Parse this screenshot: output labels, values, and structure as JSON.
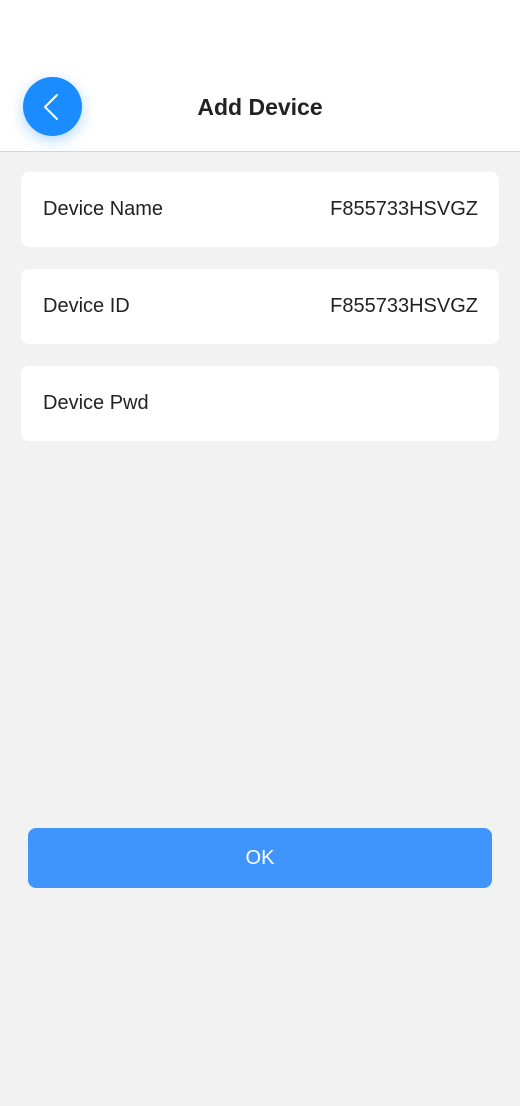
{
  "header": {
    "title": "Add Device",
    "back_icon": "chevron-left-icon"
  },
  "fields": [
    {
      "label": "Device Name",
      "value": "F855733HSVGZ"
    },
    {
      "label": "Device ID",
      "value": "F855733HSVGZ"
    },
    {
      "label": "Device Pwd",
      "value": "",
      "placeholder": ""
    }
  ],
  "ok_button": {
    "label": "OK"
  },
  "colors": {
    "accent": "#1a8cff",
    "button": "#3f95fb",
    "background": "#f2f2f3",
    "card": "#ffffff"
  }
}
